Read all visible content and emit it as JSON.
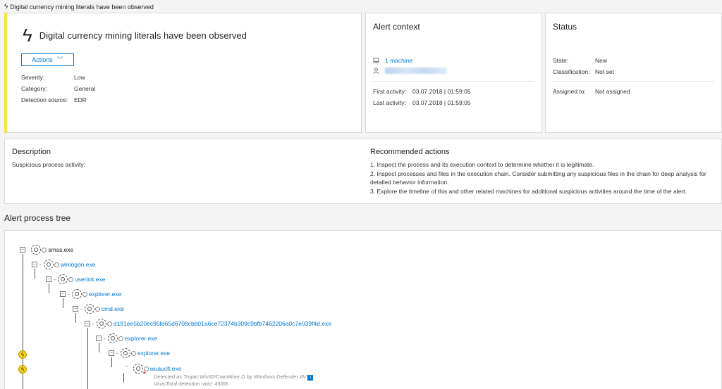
{
  "breadcrumb": {
    "icon": "lightning-icon",
    "label": "Digital currency mining literals have been observed"
  },
  "alert": {
    "title": "Digital currency mining literals have been observed",
    "actions_label": "Actions",
    "accent_color": "#f4e542",
    "fields": [
      {
        "key": "Severity:",
        "value": "Low"
      },
      {
        "key": "Category:",
        "value": "General"
      },
      {
        "key": "Detection source:",
        "value": "EDR"
      }
    ]
  },
  "context": {
    "title": "Alert context",
    "machine_link": "1 machine",
    "first_activity_key": "First activity:",
    "first_activity_value": "03.07.2018 | 01:59:05",
    "last_activity_key": "Last activity:",
    "last_activity_value": "03.07.2018 | 01:59:05"
  },
  "status": {
    "title": "Status",
    "state_key": "State:",
    "state_value": "New",
    "classification_key": "Classification:",
    "classification_value": "Not set",
    "assigned_key": "Assigned to:",
    "assigned_value": "Not assigned"
  },
  "description": {
    "title": "Description",
    "text": "Suspicious process activity:"
  },
  "recommended": {
    "title": "Recommended actions",
    "items": [
      "1. Inspect the process and its execution context to determine whether it is legitimate.",
      "2. Inspect processes and files in the execution chain. Consider submitting any suspicious files in the chain for deep analysis for detailed behavior information.",
      "3. Explore the timeline of this and other related machines for additional suspicious activities around the time of the alert."
    ]
  },
  "tree": {
    "title": "Alert process tree",
    "nodes": [
      {
        "name": "smss.exe"
      },
      {
        "name": "winlogon.exe"
      },
      {
        "name": "userinit.exe"
      },
      {
        "name": "explorer.exe"
      },
      {
        "name": "cmd.exe"
      },
      {
        "name": "d191ee5b20ec95fe65d6708cbb01a6ce72374b309c9bfb7462206a0c7e039f4d.exe"
      },
      {
        "name": "explorer.exe"
      },
      {
        "name": "explorer.exe"
      },
      {
        "name": "wuauclt.exe"
      }
    ],
    "detection_text": "Detected as Trojan:Win32/CoinMiner.D by Windows Defender AV",
    "virustotal_text": "VirusTotal detection ratio: 45/65"
  }
}
